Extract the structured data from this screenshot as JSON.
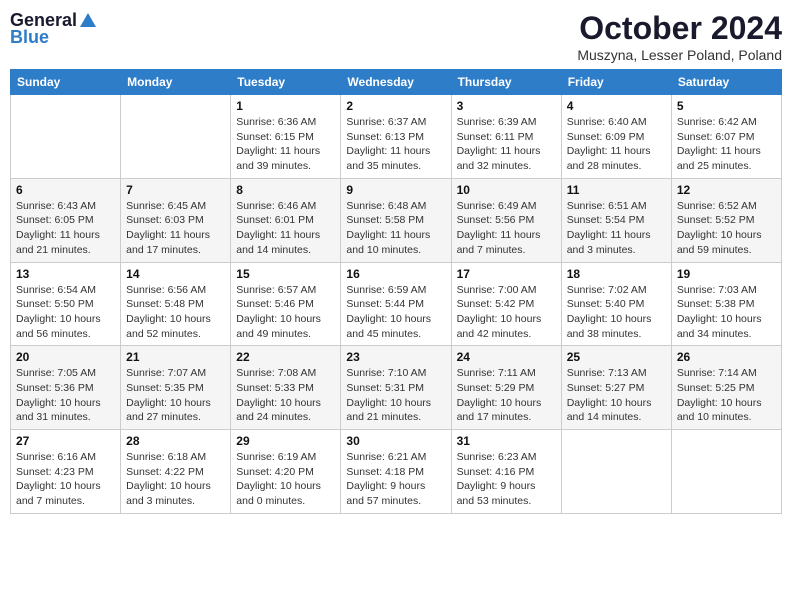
{
  "logo": {
    "general": "General",
    "blue": "Blue"
  },
  "header": {
    "month": "October 2024",
    "location": "Muszyna, Lesser Poland, Poland"
  },
  "days_of_week": [
    "Sunday",
    "Monday",
    "Tuesday",
    "Wednesday",
    "Thursday",
    "Friday",
    "Saturday"
  ],
  "weeks": [
    [
      {
        "day": "",
        "info": ""
      },
      {
        "day": "",
        "info": ""
      },
      {
        "day": "1",
        "info": "Sunrise: 6:36 AM\nSunset: 6:15 PM\nDaylight: 11 hours and 39 minutes."
      },
      {
        "day": "2",
        "info": "Sunrise: 6:37 AM\nSunset: 6:13 PM\nDaylight: 11 hours and 35 minutes."
      },
      {
        "day": "3",
        "info": "Sunrise: 6:39 AM\nSunset: 6:11 PM\nDaylight: 11 hours and 32 minutes."
      },
      {
        "day": "4",
        "info": "Sunrise: 6:40 AM\nSunset: 6:09 PM\nDaylight: 11 hours and 28 minutes."
      },
      {
        "day": "5",
        "info": "Sunrise: 6:42 AM\nSunset: 6:07 PM\nDaylight: 11 hours and 25 minutes."
      }
    ],
    [
      {
        "day": "6",
        "info": "Sunrise: 6:43 AM\nSunset: 6:05 PM\nDaylight: 11 hours and 21 minutes."
      },
      {
        "day": "7",
        "info": "Sunrise: 6:45 AM\nSunset: 6:03 PM\nDaylight: 11 hours and 17 minutes."
      },
      {
        "day": "8",
        "info": "Sunrise: 6:46 AM\nSunset: 6:01 PM\nDaylight: 11 hours and 14 minutes."
      },
      {
        "day": "9",
        "info": "Sunrise: 6:48 AM\nSunset: 5:58 PM\nDaylight: 11 hours and 10 minutes."
      },
      {
        "day": "10",
        "info": "Sunrise: 6:49 AM\nSunset: 5:56 PM\nDaylight: 11 hours and 7 minutes."
      },
      {
        "day": "11",
        "info": "Sunrise: 6:51 AM\nSunset: 5:54 PM\nDaylight: 11 hours and 3 minutes."
      },
      {
        "day": "12",
        "info": "Sunrise: 6:52 AM\nSunset: 5:52 PM\nDaylight: 10 hours and 59 minutes."
      }
    ],
    [
      {
        "day": "13",
        "info": "Sunrise: 6:54 AM\nSunset: 5:50 PM\nDaylight: 10 hours and 56 minutes."
      },
      {
        "day": "14",
        "info": "Sunrise: 6:56 AM\nSunset: 5:48 PM\nDaylight: 10 hours and 52 minutes."
      },
      {
        "day": "15",
        "info": "Sunrise: 6:57 AM\nSunset: 5:46 PM\nDaylight: 10 hours and 49 minutes."
      },
      {
        "day": "16",
        "info": "Sunrise: 6:59 AM\nSunset: 5:44 PM\nDaylight: 10 hours and 45 minutes."
      },
      {
        "day": "17",
        "info": "Sunrise: 7:00 AM\nSunset: 5:42 PM\nDaylight: 10 hours and 42 minutes."
      },
      {
        "day": "18",
        "info": "Sunrise: 7:02 AM\nSunset: 5:40 PM\nDaylight: 10 hours and 38 minutes."
      },
      {
        "day": "19",
        "info": "Sunrise: 7:03 AM\nSunset: 5:38 PM\nDaylight: 10 hours and 34 minutes."
      }
    ],
    [
      {
        "day": "20",
        "info": "Sunrise: 7:05 AM\nSunset: 5:36 PM\nDaylight: 10 hours and 31 minutes."
      },
      {
        "day": "21",
        "info": "Sunrise: 7:07 AM\nSunset: 5:35 PM\nDaylight: 10 hours and 27 minutes."
      },
      {
        "day": "22",
        "info": "Sunrise: 7:08 AM\nSunset: 5:33 PM\nDaylight: 10 hours and 24 minutes."
      },
      {
        "day": "23",
        "info": "Sunrise: 7:10 AM\nSunset: 5:31 PM\nDaylight: 10 hours and 21 minutes."
      },
      {
        "day": "24",
        "info": "Sunrise: 7:11 AM\nSunset: 5:29 PM\nDaylight: 10 hours and 17 minutes."
      },
      {
        "day": "25",
        "info": "Sunrise: 7:13 AM\nSunset: 5:27 PM\nDaylight: 10 hours and 14 minutes."
      },
      {
        "day": "26",
        "info": "Sunrise: 7:14 AM\nSunset: 5:25 PM\nDaylight: 10 hours and 10 minutes."
      }
    ],
    [
      {
        "day": "27",
        "info": "Sunrise: 6:16 AM\nSunset: 4:23 PM\nDaylight: 10 hours and 7 minutes."
      },
      {
        "day": "28",
        "info": "Sunrise: 6:18 AM\nSunset: 4:22 PM\nDaylight: 10 hours and 3 minutes."
      },
      {
        "day": "29",
        "info": "Sunrise: 6:19 AM\nSunset: 4:20 PM\nDaylight: 10 hours and 0 minutes."
      },
      {
        "day": "30",
        "info": "Sunrise: 6:21 AM\nSunset: 4:18 PM\nDaylight: 9 hours and 57 minutes."
      },
      {
        "day": "31",
        "info": "Sunrise: 6:23 AM\nSunset: 4:16 PM\nDaylight: 9 hours and 53 minutes."
      },
      {
        "day": "",
        "info": ""
      },
      {
        "day": "",
        "info": ""
      }
    ]
  ]
}
